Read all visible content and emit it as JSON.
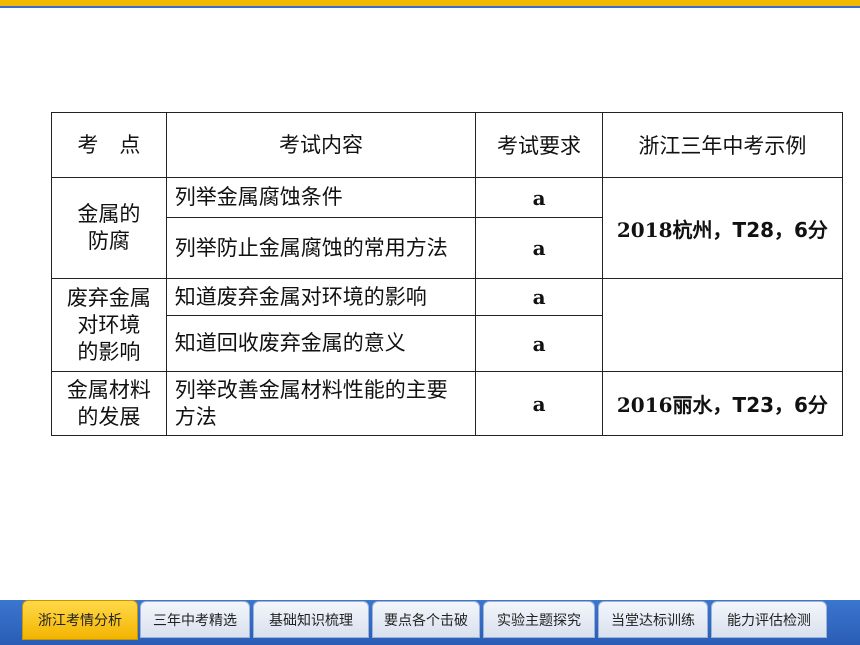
{
  "table": {
    "headers": [
      "考　点",
      "考试内容",
      "考试要求",
      "浙江三年中考示例"
    ],
    "groups": [
      {
        "topic": "金属的防腐",
        "topic_lines": [
          "金属的",
          "防腐"
        ],
        "items": [
          {
            "content": "列举金属腐蚀条件",
            "grade": "a"
          },
          {
            "content": "列举防止金属腐蚀的常用方法",
            "grade": "a"
          }
        ],
        "example": {
          "num": "2018",
          "text": "杭州，T28，6分"
        }
      },
      {
        "topic": "废弃金属对环境的影响",
        "topic_lines": [
          "废弃金属",
          "对环境",
          "的影响"
        ],
        "items": [
          {
            "content": "知道废弃金属对环境的影响",
            "grade": "a"
          },
          {
            "content": "知道回收废弃金属的意义",
            "grade": "a"
          }
        ],
        "example": {
          "num": "",
          "text": ""
        }
      },
      {
        "topic": "金属材料的发展",
        "topic_lines": [
          "金属材料",
          "的发展"
        ],
        "items": [
          {
            "content": "列举改善金属材料性能的主要方法",
            "grade": "a"
          }
        ],
        "example": {
          "num": "2016",
          "text": "丽水，T23，6分"
        }
      }
    ]
  },
  "nav": {
    "tabs": [
      "浙江考情分析",
      "三年中考精选",
      "基础知识梳理",
      "要点各个击破",
      "实验主题探究",
      "当堂达标训练",
      "能力评估检测"
    ],
    "active_index": 0
  },
  "colors": {
    "accent_bar": "#f5b800",
    "nav_blue": "#2a5db5",
    "active_tab": "#f3b400"
  }
}
